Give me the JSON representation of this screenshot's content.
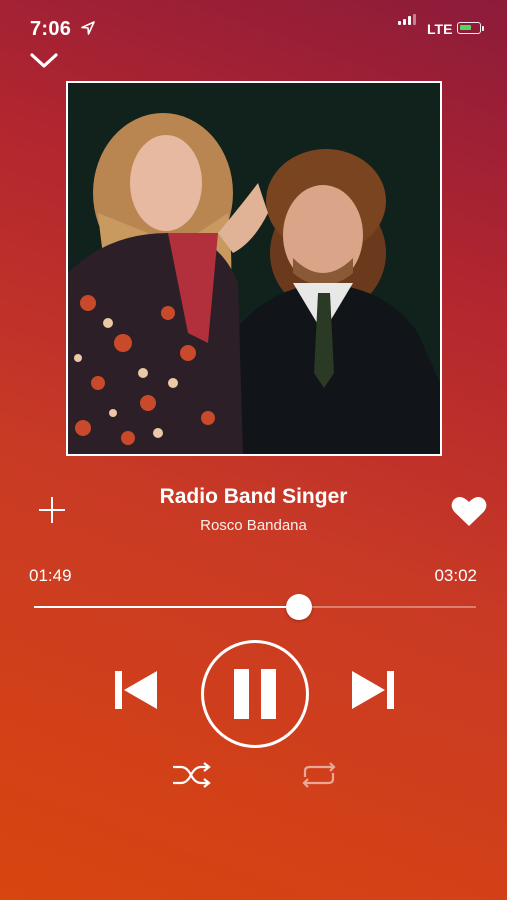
{
  "status_bar": {
    "time": "7:06",
    "carrier": "LTE",
    "location_icon": "location-arrow-icon",
    "signal_icon": "signal-bars-icon",
    "battery_icon": "battery-charging-icon",
    "battery_color": "#4cd964"
  },
  "player": {
    "collapse_icon": "chevron-down-icon",
    "album_art_icon": "album-cover-photo",
    "track_title": "Radio Band Singer",
    "artist": "Rosco Bandana",
    "add_icon": "plus-icon",
    "like_icon": "heart-icon",
    "liked": true,
    "time_elapsed": "01:49",
    "time_total": "03:02",
    "progress_fraction": 0.6,
    "controls": {
      "previous_icon": "skip-previous-icon",
      "play_pause_icon": "pause-icon",
      "next_icon": "skip-next-icon",
      "shuffle_icon": "shuffle-icon",
      "repeat_icon": "repeat-icon",
      "repeat_active": false
    }
  },
  "theme": {
    "gradient_top": "#8c1b3a",
    "gradient_mid": "#c93a25",
    "gradient_bottom": "#d8450f",
    "foreground": "#ffffff"
  }
}
